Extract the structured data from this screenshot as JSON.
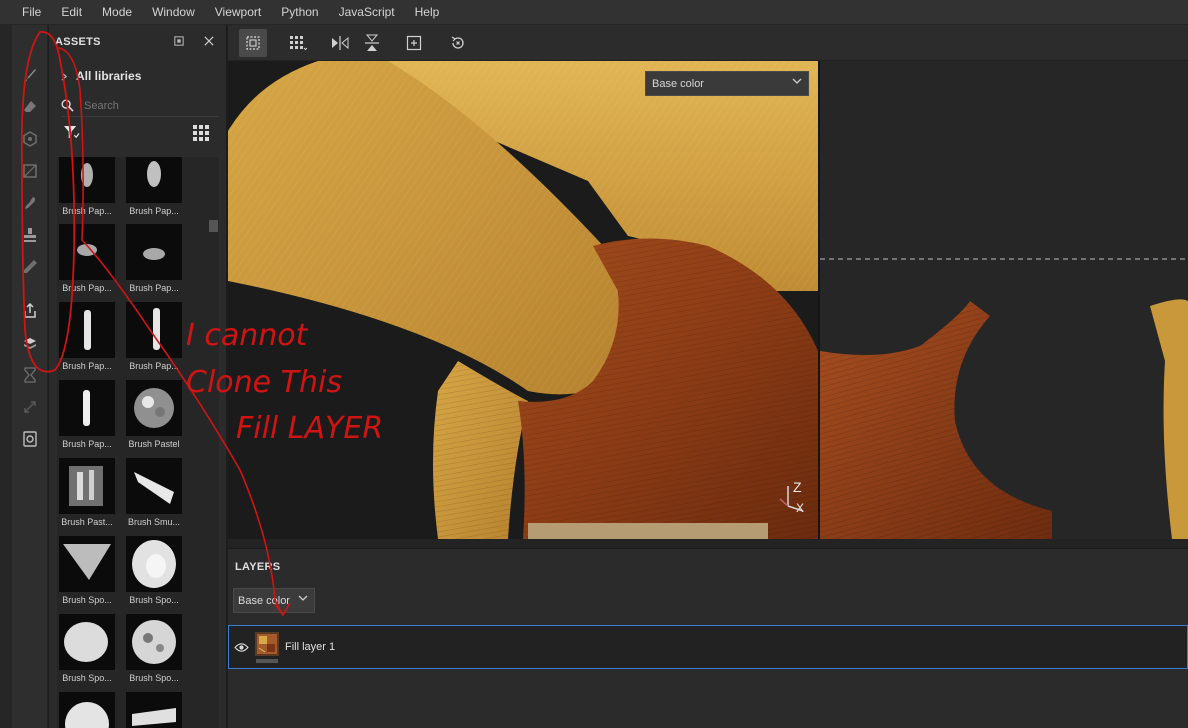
{
  "menubar": {
    "items": [
      "File",
      "Edit",
      "Mode",
      "Window",
      "Viewport",
      "Python",
      "JavaScript",
      "Help"
    ]
  },
  "toolstrip": {
    "tools": [
      "paint-brush-icon",
      "eraser-icon",
      "projection-icon",
      "polygon-fill-icon",
      "smudge-icon",
      "clone-stamp-icon",
      "color-picker-icon",
      "export-icon",
      "bake-icon",
      "hourglass-icon",
      "resize-icon",
      "render-icon"
    ]
  },
  "assets": {
    "title": "ASSETS",
    "all_libraries": "All libraries",
    "search_placeholder": "Search",
    "thumbnails": [
      {
        "label": "Brush Pap..."
      },
      {
        "label": "Brush Pap..."
      },
      {
        "label": "Brush Pap..."
      },
      {
        "label": "Brush Pap..."
      },
      {
        "label": "Brush Pap..."
      },
      {
        "label": "Brush Pap..."
      },
      {
        "label": "Brush Pap..."
      },
      {
        "label": "Brush Pastel"
      },
      {
        "label": "Brush Past..."
      },
      {
        "label": "Brush Smu..."
      },
      {
        "label": "Brush Spo..."
      },
      {
        "label": "Brush Spo..."
      },
      {
        "label": "Brush Spo..."
      },
      {
        "label": "Brush Spo..."
      },
      {
        "label": ""
      },
      {
        "label": ""
      }
    ]
  },
  "toolbar": {
    "buttons": [
      "select-icon",
      "grid-icon",
      "mirror-x-icon",
      "mirror-y-icon",
      "frame-icon",
      "reset-icon"
    ]
  },
  "viewport": {
    "channel": "Base color",
    "axis_z": "Z",
    "axis_x": "X"
  },
  "layers": {
    "title": "LAYERS",
    "channel": "Base color",
    "items": [
      {
        "name": "Fill layer 1",
        "visible": true
      }
    ]
  },
  "annotation": {
    "lines": [
      "I cannot",
      "Clone This",
      "Fill LAYER"
    ],
    "color": "#d01414"
  }
}
